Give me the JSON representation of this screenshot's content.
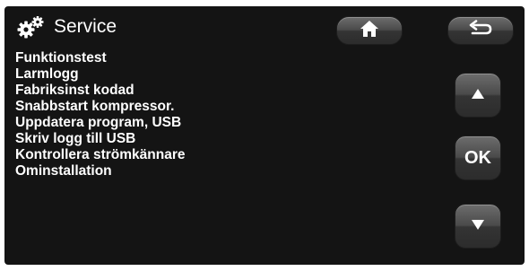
{
  "header": {
    "title": "Service",
    "icon": "gears-icon"
  },
  "menu": {
    "items": [
      "Funktionstest",
      "Larmlogg",
      "Fabriksinst kodad",
      "Snabbstart kompressor.",
      "Uppdatera program, USB",
      "Skriv logg till USB",
      "Kontrollera strömkännare",
      "Ominstallation"
    ]
  },
  "buttons": {
    "home_icon": "home-icon",
    "back_icon": "back-arrow-icon",
    "up_icon": "up-arrow-icon",
    "ok_label": "OK",
    "down_icon": "down-arrow-icon"
  },
  "colors": {
    "screen_background": "#141414",
    "text": "#ffffff",
    "button": "#4a4a4a"
  }
}
